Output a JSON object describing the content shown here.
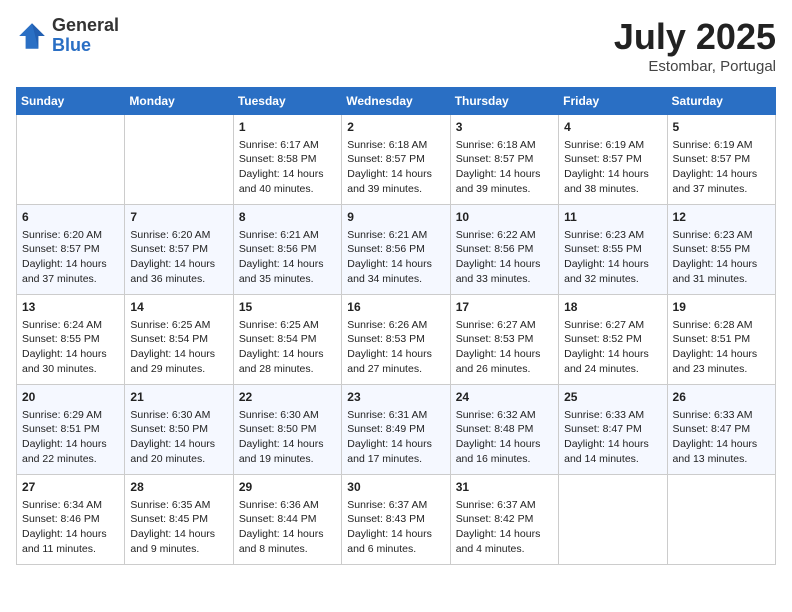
{
  "header": {
    "logo_general": "General",
    "logo_blue": "Blue",
    "month_title": "July 2025",
    "location": "Estombar, Portugal"
  },
  "weekdays": [
    "Sunday",
    "Monday",
    "Tuesday",
    "Wednesday",
    "Thursday",
    "Friday",
    "Saturday"
  ],
  "weeks": [
    [
      {
        "day": "",
        "sunrise": "",
        "sunset": "",
        "daylight": ""
      },
      {
        "day": "",
        "sunrise": "",
        "sunset": "",
        "daylight": ""
      },
      {
        "day": "1",
        "sunrise": "Sunrise: 6:17 AM",
        "sunset": "Sunset: 8:58 PM",
        "daylight": "Daylight: 14 hours and 40 minutes."
      },
      {
        "day": "2",
        "sunrise": "Sunrise: 6:18 AM",
        "sunset": "Sunset: 8:57 PM",
        "daylight": "Daylight: 14 hours and 39 minutes."
      },
      {
        "day": "3",
        "sunrise": "Sunrise: 6:18 AM",
        "sunset": "Sunset: 8:57 PM",
        "daylight": "Daylight: 14 hours and 39 minutes."
      },
      {
        "day": "4",
        "sunrise": "Sunrise: 6:19 AM",
        "sunset": "Sunset: 8:57 PM",
        "daylight": "Daylight: 14 hours and 38 minutes."
      },
      {
        "day": "5",
        "sunrise": "Sunrise: 6:19 AM",
        "sunset": "Sunset: 8:57 PM",
        "daylight": "Daylight: 14 hours and 37 minutes."
      }
    ],
    [
      {
        "day": "6",
        "sunrise": "Sunrise: 6:20 AM",
        "sunset": "Sunset: 8:57 PM",
        "daylight": "Daylight: 14 hours and 37 minutes."
      },
      {
        "day": "7",
        "sunrise": "Sunrise: 6:20 AM",
        "sunset": "Sunset: 8:57 PM",
        "daylight": "Daylight: 14 hours and 36 minutes."
      },
      {
        "day": "8",
        "sunrise": "Sunrise: 6:21 AM",
        "sunset": "Sunset: 8:56 PM",
        "daylight": "Daylight: 14 hours and 35 minutes."
      },
      {
        "day": "9",
        "sunrise": "Sunrise: 6:21 AM",
        "sunset": "Sunset: 8:56 PM",
        "daylight": "Daylight: 14 hours and 34 minutes."
      },
      {
        "day": "10",
        "sunrise": "Sunrise: 6:22 AM",
        "sunset": "Sunset: 8:56 PM",
        "daylight": "Daylight: 14 hours and 33 minutes."
      },
      {
        "day": "11",
        "sunrise": "Sunrise: 6:23 AM",
        "sunset": "Sunset: 8:55 PM",
        "daylight": "Daylight: 14 hours and 32 minutes."
      },
      {
        "day": "12",
        "sunrise": "Sunrise: 6:23 AM",
        "sunset": "Sunset: 8:55 PM",
        "daylight": "Daylight: 14 hours and 31 minutes."
      }
    ],
    [
      {
        "day": "13",
        "sunrise": "Sunrise: 6:24 AM",
        "sunset": "Sunset: 8:55 PM",
        "daylight": "Daylight: 14 hours and 30 minutes."
      },
      {
        "day": "14",
        "sunrise": "Sunrise: 6:25 AM",
        "sunset": "Sunset: 8:54 PM",
        "daylight": "Daylight: 14 hours and 29 minutes."
      },
      {
        "day": "15",
        "sunrise": "Sunrise: 6:25 AM",
        "sunset": "Sunset: 8:54 PM",
        "daylight": "Daylight: 14 hours and 28 minutes."
      },
      {
        "day": "16",
        "sunrise": "Sunrise: 6:26 AM",
        "sunset": "Sunset: 8:53 PM",
        "daylight": "Daylight: 14 hours and 27 minutes."
      },
      {
        "day": "17",
        "sunrise": "Sunrise: 6:27 AM",
        "sunset": "Sunset: 8:53 PM",
        "daylight": "Daylight: 14 hours and 26 minutes."
      },
      {
        "day": "18",
        "sunrise": "Sunrise: 6:27 AM",
        "sunset": "Sunset: 8:52 PM",
        "daylight": "Daylight: 14 hours and 24 minutes."
      },
      {
        "day": "19",
        "sunrise": "Sunrise: 6:28 AM",
        "sunset": "Sunset: 8:51 PM",
        "daylight": "Daylight: 14 hours and 23 minutes."
      }
    ],
    [
      {
        "day": "20",
        "sunrise": "Sunrise: 6:29 AM",
        "sunset": "Sunset: 8:51 PM",
        "daylight": "Daylight: 14 hours and 22 minutes."
      },
      {
        "day": "21",
        "sunrise": "Sunrise: 6:30 AM",
        "sunset": "Sunset: 8:50 PM",
        "daylight": "Daylight: 14 hours and 20 minutes."
      },
      {
        "day": "22",
        "sunrise": "Sunrise: 6:30 AM",
        "sunset": "Sunset: 8:50 PM",
        "daylight": "Daylight: 14 hours and 19 minutes."
      },
      {
        "day": "23",
        "sunrise": "Sunrise: 6:31 AM",
        "sunset": "Sunset: 8:49 PM",
        "daylight": "Daylight: 14 hours and 17 minutes."
      },
      {
        "day": "24",
        "sunrise": "Sunrise: 6:32 AM",
        "sunset": "Sunset: 8:48 PM",
        "daylight": "Daylight: 14 hours and 16 minutes."
      },
      {
        "day": "25",
        "sunrise": "Sunrise: 6:33 AM",
        "sunset": "Sunset: 8:47 PM",
        "daylight": "Daylight: 14 hours and 14 minutes."
      },
      {
        "day": "26",
        "sunrise": "Sunrise: 6:33 AM",
        "sunset": "Sunset: 8:47 PM",
        "daylight": "Daylight: 14 hours and 13 minutes."
      }
    ],
    [
      {
        "day": "27",
        "sunrise": "Sunrise: 6:34 AM",
        "sunset": "Sunset: 8:46 PM",
        "daylight": "Daylight: 14 hours and 11 minutes."
      },
      {
        "day": "28",
        "sunrise": "Sunrise: 6:35 AM",
        "sunset": "Sunset: 8:45 PM",
        "daylight": "Daylight: 14 hours and 9 minutes."
      },
      {
        "day": "29",
        "sunrise": "Sunrise: 6:36 AM",
        "sunset": "Sunset: 8:44 PM",
        "daylight": "Daylight: 14 hours and 8 minutes."
      },
      {
        "day": "30",
        "sunrise": "Sunrise: 6:37 AM",
        "sunset": "Sunset: 8:43 PM",
        "daylight": "Daylight: 14 hours and 6 minutes."
      },
      {
        "day": "31",
        "sunrise": "Sunrise: 6:37 AM",
        "sunset": "Sunset: 8:42 PM",
        "daylight": "Daylight: 14 hours and 4 minutes."
      },
      {
        "day": "",
        "sunrise": "",
        "sunset": "",
        "daylight": ""
      },
      {
        "day": "",
        "sunrise": "",
        "sunset": "",
        "daylight": ""
      }
    ]
  ]
}
